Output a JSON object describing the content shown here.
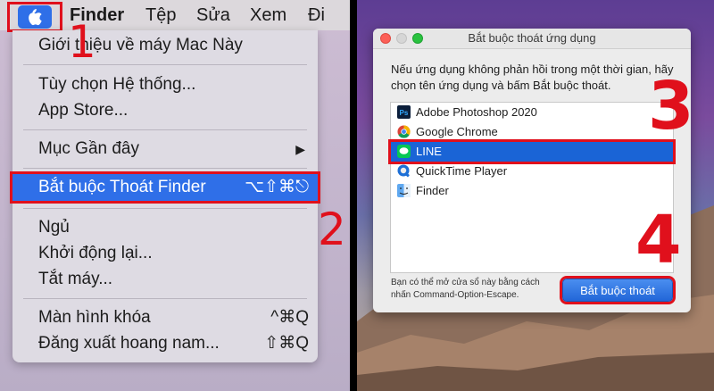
{
  "menubar": {
    "items": [
      "Finder",
      "Tệp",
      "Sửa",
      "Xem",
      "Đi"
    ]
  },
  "apple_menu": {
    "items": [
      {
        "label": "Giới thiệu về máy Mac Này",
        "shortcut": ""
      },
      {
        "label": "Tùy chọn Hệ thống...",
        "shortcut": ""
      },
      {
        "label": "App Store...",
        "shortcut": ""
      },
      {
        "label": "Mục Gần đây",
        "shortcut": "▶"
      },
      {
        "label": "Bắt buộc Thoát Finder",
        "shortcut": "⌥⇧⌘⎋"
      },
      {
        "label": "Ngủ",
        "shortcut": ""
      },
      {
        "label": "Khởi động lại...",
        "shortcut": ""
      },
      {
        "label": "Tắt máy...",
        "shortcut": ""
      },
      {
        "label": "Màn hình khóa",
        "shortcut": "^⌘Q"
      },
      {
        "label": "Đăng xuất hoang nam...",
        "shortcut": "⇧⌘Q"
      }
    ]
  },
  "dialog": {
    "title": "Bắt buộc thoát ứng dụng",
    "description": "Nếu ứng dụng không phản hồi trong một thời gian, hãy chọn tên ứng dụng và bấm Bắt buộc thoát.",
    "apps": [
      {
        "name": "Adobe Photoshop 2020",
        "icon": "photoshop-icon"
      },
      {
        "name": "Google Chrome",
        "icon": "chrome-icon"
      },
      {
        "name": "LINE",
        "icon": "line-icon"
      },
      {
        "name": "QuickTime Player",
        "icon": "quicktime-icon"
      },
      {
        "name": "Finder",
        "icon": "finder-icon"
      }
    ],
    "selected_app": "LINE",
    "footer": "Bạn có thể mở cửa sổ này bằng cách nhấn Command-Option-Escape.",
    "button_label": "Bắt buộc thoát"
  },
  "steps": [
    "1",
    "2",
    "3",
    "4"
  ],
  "colors": {
    "highlight_red": "#e0101c",
    "selection_blue": "#2f6fe8"
  }
}
